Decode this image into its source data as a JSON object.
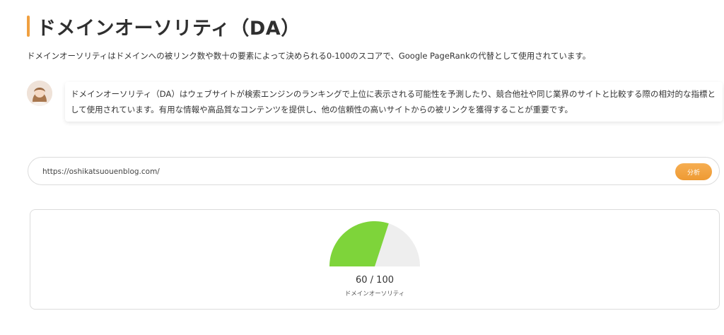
{
  "section": {
    "title": "ドメインオーソリティ（DA）",
    "accent_color": "#f0a040"
  },
  "intro": {
    "text": "ドメインオーソリティはドメインへの被リンク数や数十の要素によって決められる0-100のスコアで、Google PageRankの代替として使用されています。"
  },
  "speech": {
    "avatar": "avatar-icon",
    "text": "ドメインオーソリティ（DA）はウェブサイトが検索エンジンのランキングで上位に表示される可能性を予測したり、競合他社や同じ業界のサイトと比較する際の相対的な指標として使用されています。有用な情報や高品質なコンテンツを提供し、他の信頼性の高いサイトからの被リンクを獲得することが重要です。"
  },
  "analyzer": {
    "url_value": "https://oshikatsuouenblog.com/",
    "button_label": "分析",
    "button_color": "#f0a040"
  },
  "result": {
    "score_value": 60,
    "score_max": 100,
    "score_text": "60 / 100",
    "label": "ドメインオーソリティ",
    "fill_color": "#7ed43a",
    "track_color": "#eeeeee"
  }
}
